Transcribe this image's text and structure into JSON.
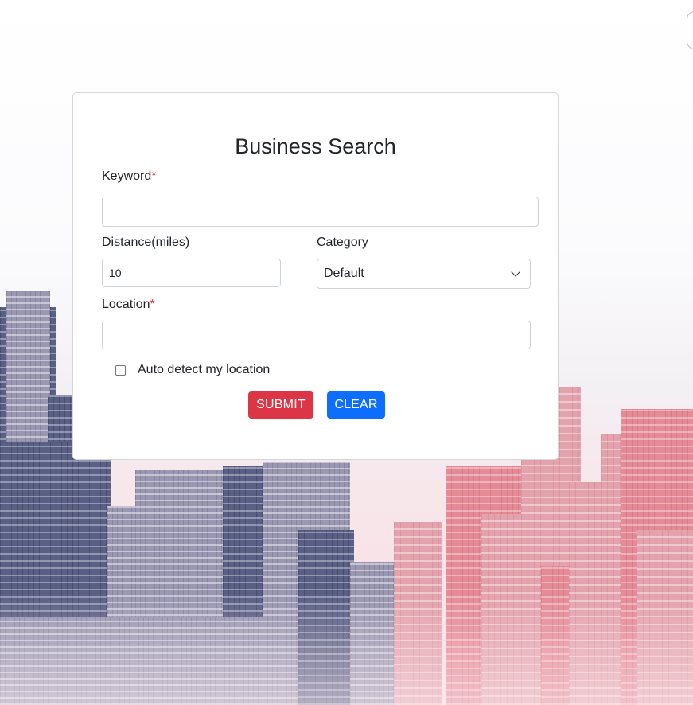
{
  "form": {
    "title": "Business Search",
    "keyword": {
      "label": "Keyword",
      "required_mark": "*",
      "value": ""
    },
    "distance": {
      "label": "Distance(miles)",
      "value": "10"
    },
    "category": {
      "label": "Category",
      "selected": "Default"
    },
    "location": {
      "label": "Location",
      "required_mark": "*",
      "value": ""
    },
    "auto_detect": {
      "label": "Auto detect my location",
      "checked": false
    },
    "submit_label": "SUBMIT",
    "clear_label": "CLEAR"
  },
  "colors": {
    "submit": "#dc3545",
    "clear": "#0d6efd",
    "required": "#dc3545"
  }
}
